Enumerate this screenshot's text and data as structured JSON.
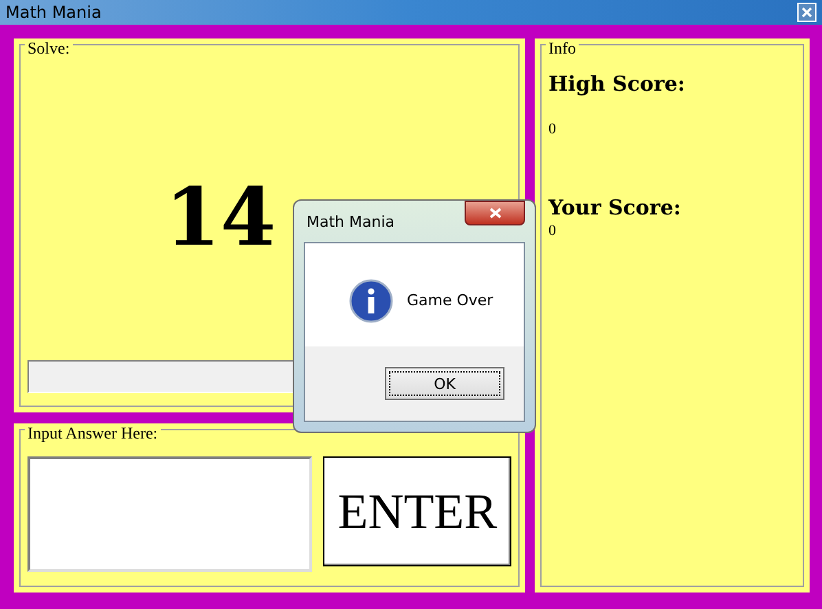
{
  "window": {
    "title": "Math Mania"
  },
  "solve": {
    "legend": "Solve:",
    "problem": "14"
  },
  "input": {
    "legend": "Input Answer Here:",
    "button": "ENTER"
  },
  "info": {
    "legend": "Info",
    "high_score_label": "High Score:",
    "high_score": "0",
    "your_score_label": "Your Score:",
    "your_score": "0"
  },
  "dialog": {
    "title": "Math Mania",
    "message": "Game Over",
    "button": "OK"
  }
}
